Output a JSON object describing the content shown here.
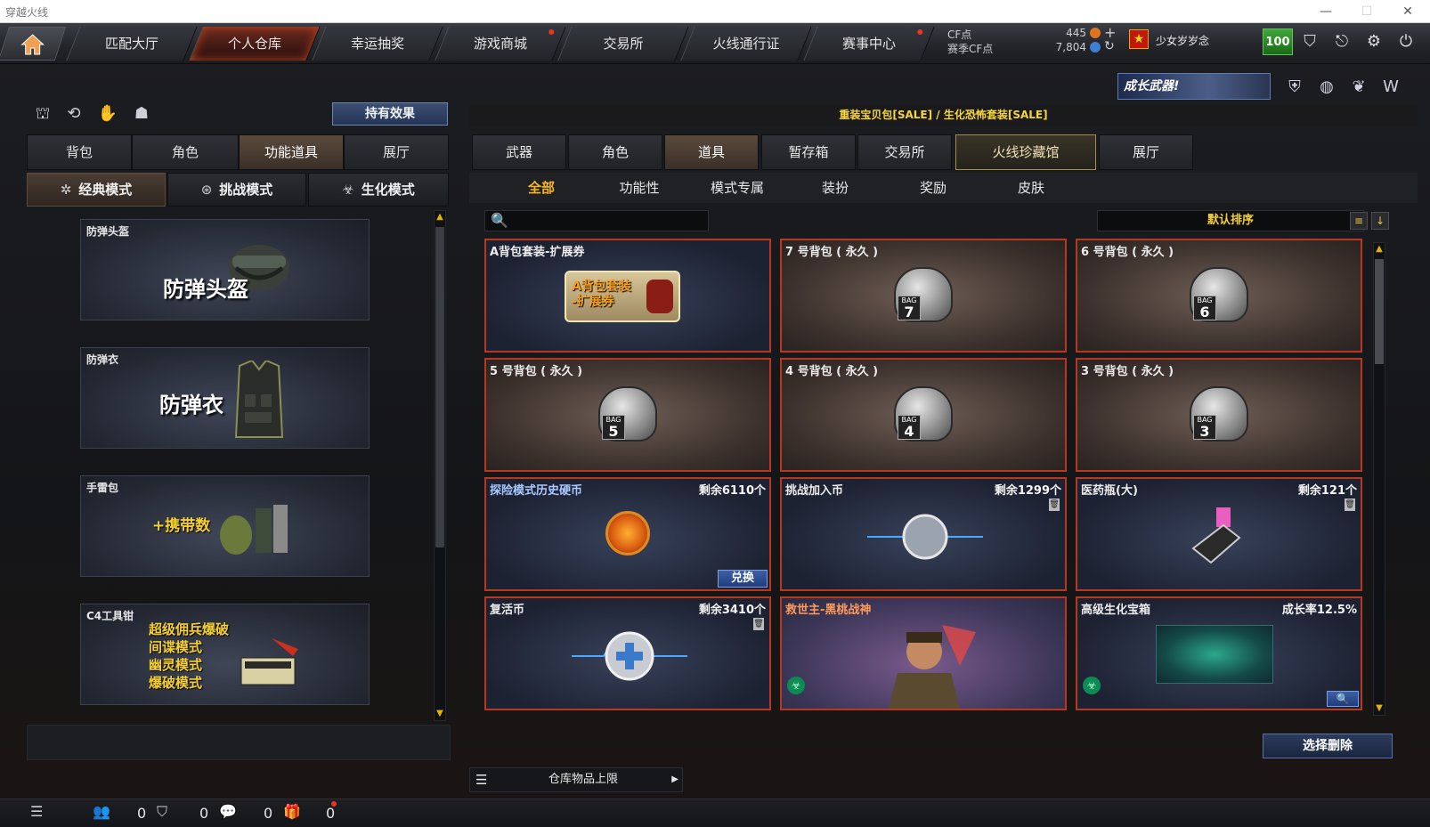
{
  "window": {
    "title": "穿越火线"
  },
  "top_nav": {
    "tabs": [
      {
        "label": "匹配大厅",
        "active": false,
        "dot": false
      },
      {
        "label": "个人仓库",
        "active": true,
        "dot": false
      },
      {
        "label": "幸运抽奖",
        "active": false,
        "dot": false
      },
      {
        "label": "游戏商城",
        "active": false,
        "dot": true
      },
      {
        "label": "交易所",
        "active": false,
        "dot": false
      },
      {
        "label": "火线通行证",
        "active": false,
        "dot": false
      },
      {
        "label": "赛事中心",
        "active": false,
        "dot": true
      }
    ],
    "cf_label": "CF点",
    "cf_value": "445",
    "season_cf_label": "赛季CF点",
    "season_cf_value": "7,804",
    "player_name": "少女岁岁念",
    "level": "100"
  },
  "left": {
    "effect_button": "持有效果",
    "tabs": [
      {
        "label": "背包",
        "active": false
      },
      {
        "label": "角色",
        "active": false
      },
      {
        "label": "功能道具",
        "active": true
      },
      {
        "label": "展厅",
        "active": false
      }
    ],
    "modes": [
      {
        "label": "经典模式",
        "active": true
      },
      {
        "label": "挑战模式",
        "active": false
      },
      {
        "label": "生化模式",
        "active": false
      }
    ],
    "slots": [
      {
        "label": "防弹头盔",
        "big": "防弹头盔"
      },
      {
        "label": "防弹衣",
        "big": "防弹衣"
      },
      {
        "label": "手雷包",
        "big": "+携带数"
      },
      {
        "label": "C4工具钳",
        "lines": [
          "超级佣兵爆破",
          "间谍模式",
          "幽灵模式",
          "爆破模式"
        ]
      }
    ]
  },
  "right": {
    "growth_banner": "成长武器!",
    "promo": "重装宝贝包[SALE] / 生化恐怖套装[SALE]",
    "tabs": [
      {
        "label": "武器",
        "active": false
      },
      {
        "label": "角色",
        "active": false
      },
      {
        "label": "道具",
        "active": true
      },
      {
        "label": "暂存箱",
        "active": false
      },
      {
        "label": "交易所",
        "active": false
      },
      {
        "label": "火线珍藏馆",
        "active": false
      },
      {
        "label": "展厅",
        "active": false
      }
    ],
    "subtabs": [
      {
        "label": "全部",
        "active": true
      },
      {
        "label": "功能性",
        "active": false
      },
      {
        "label": "模式专属",
        "active": false
      },
      {
        "label": "装扮",
        "active": false
      },
      {
        "label": "奖励",
        "active": false
      },
      {
        "label": "皮肤",
        "active": false
      }
    ],
    "search_placeholder": "",
    "sort_label": "默认排序",
    "items": [
      {
        "name": "A背包套装-扩展券",
        "count": "",
        "img_text": "A背包套装\n-扩展券"
      },
      {
        "name": "7 号背包 ( 永久 )",
        "count": "",
        "bag": "7"
      },
      {
        "name": "6 号背包 ( 永久 )",
        "count": "",
        "bag": "6"
      },
      {
        "name": "5 号背包 ( 永久 )",
        "count": "",
        "bag": "5"
      },
      {
        "name": "4 号背包 ( 永久 )",
        "count": "",
        "bag": "4"
      },
      {
        "name": "3 号背包 ( 永久 )",
        "count": "",
        "bag": "3"
      },
      {
        "name": "探险模式历史硬币",
        "count": "剩余6110个",
        "button": "兑换"
      },
      {
        "name": "挑战加入币",
        "count": "剩余1299个"
      },
      {
        "name": "医药瓶(大)",
        "count": "剩余121个"
      },
      {
        "name": "复活币",
        "count": "剩余3410个"
      },
      {
        "name": "救世主-黑桃战神",
        "count": ""
      },
      {
        "name": "高级生化宝箱",
        "count": "成长率12.5%"
      }
    ],
    "storage_limit": "仓库物品上限",
    "delete_button": "选择删除"
  },
  "bottom": {
    "counts": [
      "0",
      "0",
      "0",
      "0"
    ]
  }
}
